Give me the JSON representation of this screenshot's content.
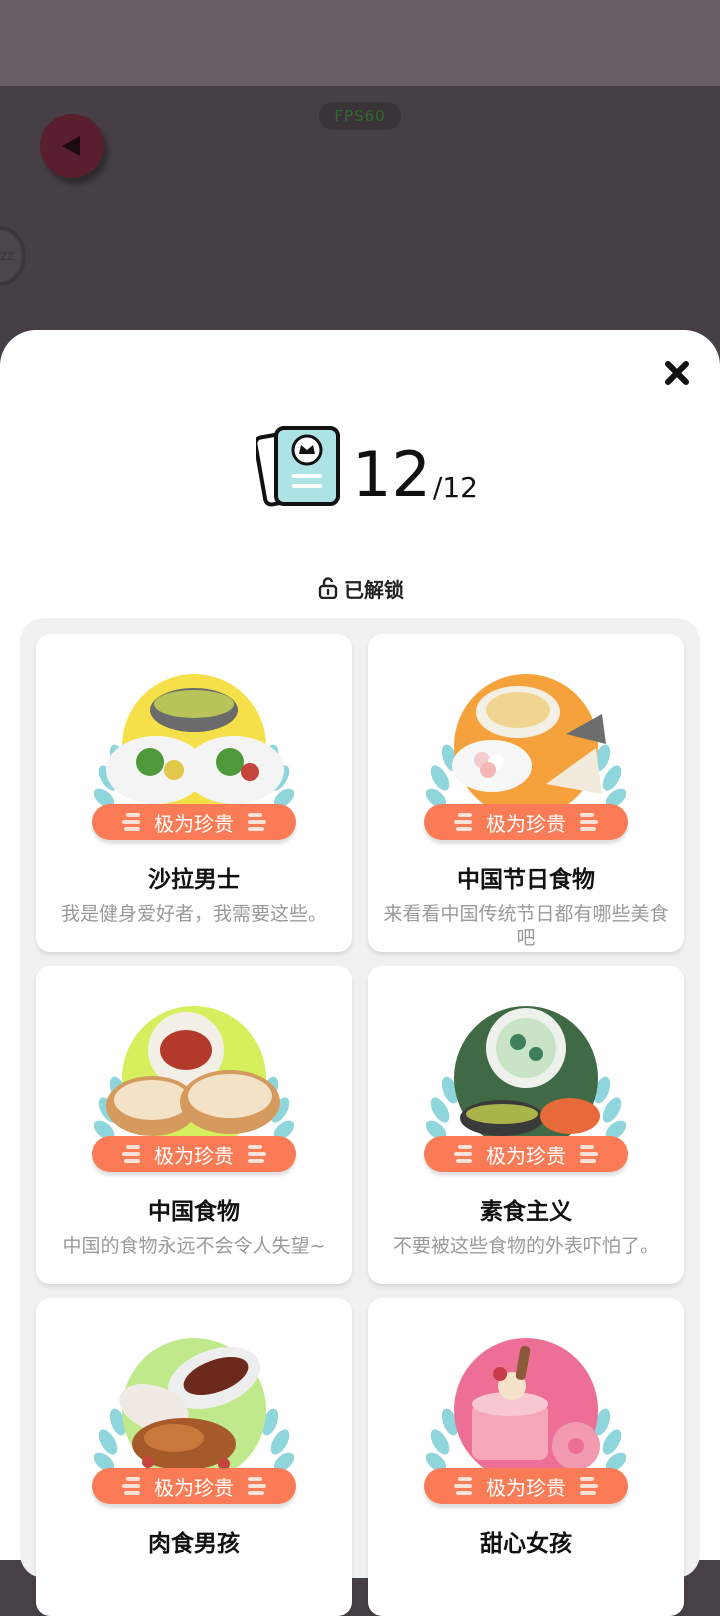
{
  "top_overlay": {
    "fps_label": "FPS60"
  },
  "collection": {
    "count_current": "12",
    "count_total": "/12",
    "status_label": "已解锁"
  },
  "cards": [
    {
      "rarity": "极为珍贵",
      "title": "沙拉男士",
      "desc": "我是健身爱好者，我需要这些。",
      "bg": "#f5e04a"
    },
    {
      "rarity": "极为珍贵",
      "title": "中国节日食物",
      "desc": "来看看中国传统节日都有哪些美食吧",
      "bg": "#f6a23c"
    },
    {
      "rarity": "极为珍贵",
      "title": "中国食物",
      "desc": "中国的食物永远不会令人失望~",
      "bg": "#d6ef5c"
    },
    {
      "rarity": "极为珍贵",
      "title": "素食主义",
      "desc": "不要被这些食物的外表吓怕了。",
      "bg": "#3f6a45"
    },
    {
      "rarity": "极为珍贵",
      "title": "肉食男孩",
      "desc": "",
      "bg": "#bfe98a"
    },
    {
      "rarity": "极为珍贵",
      "title": "甜心女孩",
      "desc": "",
      "bg": "#ee6f96"
    }
  ],
  "colors": {
    "accent": "#fa7b55",
    "laurel": "#8fd6dc",
    "back_button": "#5a1f2e"
  },
  "icons": {
    "close": "close-icon",
    "back": "back-arrow-icon",
    "collection": "card-collection-icon",
    "unlock": "unlock-icon"
  }
}
